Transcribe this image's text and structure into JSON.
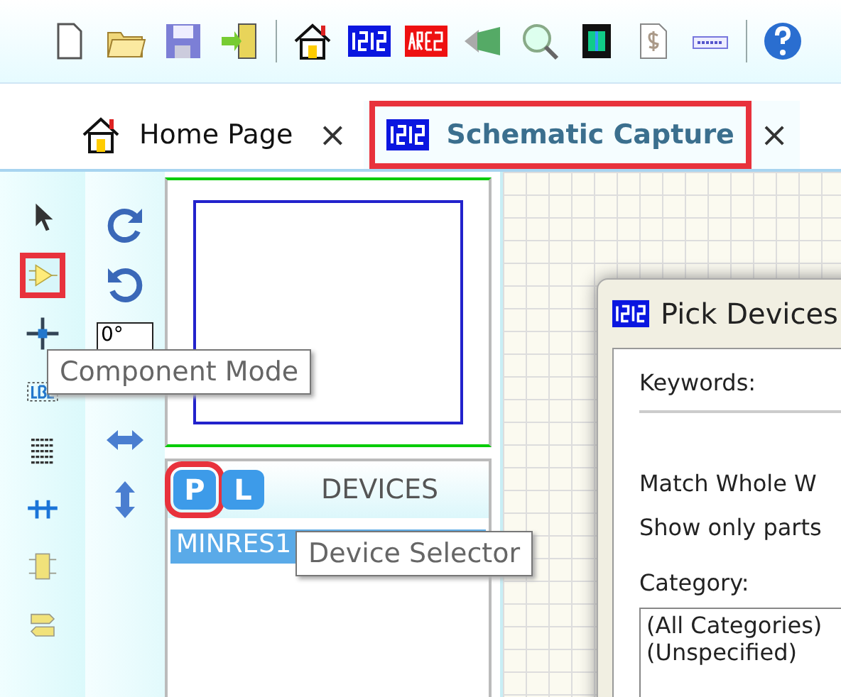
{
  "tabs": [
    {
      "label": "Home Page",
      "close": "×",
      "selected": false,
      "highlighted": false
    },
    {
      "label": "Schematic Capture",
      "close": "×",
      "selected": true,
      "highlighted": true
    }
  ],
  "mode_tools": [
    {
      "highlighted": false
    },
    {
      "highlighted": true
    },
    {
      "highlighted": false
    },
    {
      "highlighted": false
    },
    {
      "highlighted": false
    },
    {
      "highlighted": false
    },
    {
      "highlighted": false
    },
    {
      "highlighted": false
    }
  ],
  "angle_field": {
    "value": "0°"
  },
  "device_panel": {
    "buttons": [
      {
        "label": "P",
        "highlighted": true
      },
      {
        "label": "L",
        "highlighted": false
      }
    ],
    "title": "DEVICES",
    "items": [
      {
        "label": "MINRES1",
        "selected": true
      }
    ]
  },
  "dialog": {
    "title": "Pick Devices",
    "keywords_label": "Keywords:",
    "match_label": "Match Whole W",
    "show_label": "Show only parts",
    "category_label": "Category:",
    "categories": [
      {
        "label": "(All Categories)"
      },
      {
        "label": "(Unspecified)"
      }
    ]
  },
  "tooltips": [
    {
      "text": "Component Mode"
    },
    {
      "text": "Device Selector"
    }
  ]
}
